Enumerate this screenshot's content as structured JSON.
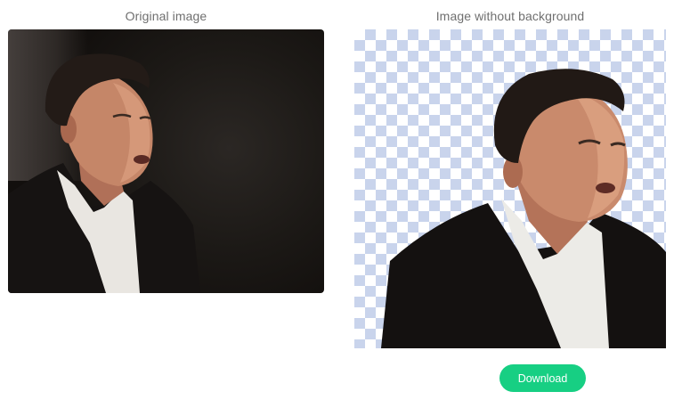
{
  "labels": {
    "original": "Original image",
    "result": "Image without background"
  },
  "actions": {
    "download_label": "Download"
  },
  "colors": {
    "accent": "#17cf83",
    "label_text": "#6f6f6f",
    "checker": "#c9d4ec"
  }
}
